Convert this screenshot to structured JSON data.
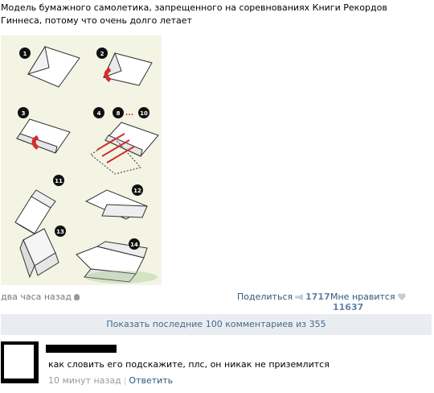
{
  "post": {
    "text": "Модель бумажного самолетика, запрещенного на соревнованиях Книги Рекордов Гиннеса, потому что очень долго летает",
    "image": {
      "step_labels": [
        "1",
        "2",
        "3",
        "4",
        "8",
        "10",
        "11",
        "12",
        "13",
        "14"
      ],
      "background_color": "#f3f4e4",
      "arrow_color": "#d32d2d"
    },
    "time": "два часа назад",
    "device_icon": "apple-icon",
    "share_label": "Поделиться",
    "share_count": "1717",
    "like_label": "Мне нравится",
    "like_count": "11637"
  },
  "comments": {
    "show_more_label": "Показать последние 100 комментариев из 355",
    "items": [
      {
        "text": "как словить его подскажите, плс, он никак не приземлится",
        "time": "10 минут назад",
        "separator": "|",
        "reply_label": "Ответить"
      }
    ]
  }
}
